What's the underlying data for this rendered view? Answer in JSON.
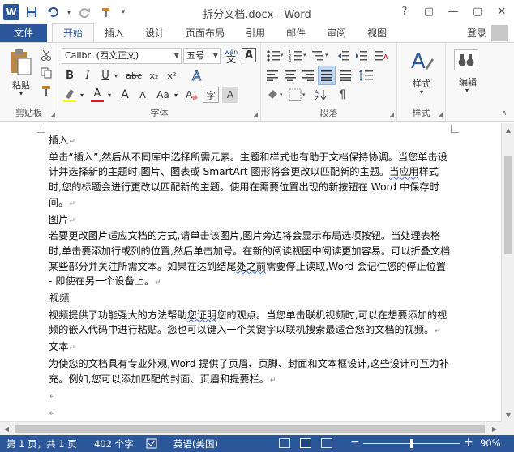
{
  "window": {
    "title": "拆分文档.docx - Word",
    "app_icon": "W",
    "help": "?",
    "restore": "▢",
    "minimize": "—",
    "close": "✕"
  },
  "qat": {
    "save_icon": "save-icon",
    "undo_icon": "undo-icon",
    "redo_icon": "redo-icon",
    "brush_icon": "format-painter-icon",
    "customize_icon": "chevron-down-icon"
  },
  "tabs": {
    "file": "文件",
    "items": [
      "开始",
      "插入",
      "设计",
      "页面布局",
      "引用",
      "邮件",
      "审阅",
      "视图"
    ],
    "active": "开始"
  },
  "account": {
    "login": "登录"
  },
  "ribbon": {
    "clipboard": {
      "label": "剪贴板",
      "paste": "粘贴"
    },
    "font": {
      "label": "字体",
      "font_name": "Calibri (西文正文)",
      "font_size": "五号",
      "pinyin": "wén",
      "bold": "B",
      "italic": "I",
      "underline": "U",
      "strike": "abc",
      "subscript": "x₂",
      "superscript": "x²",
      "grow": "A",
      "shrink": "A",
      "aa": "Aa",
      "font_color": "A",
      "highlight": "ab",
      "border_a": "A"
    },
    "paragraph": {
      "label": "段落"
    },
    "styles": {
      "label": "样式",
      "button": "样式"
    },
    "editing": {
      "button": "编辑"
    }
  },
  "document": {
    "paragraphs": [
      {
        "text": "插入",
        "mark": "↵"
      },
      {
        "text": "单击“插入”,然后从不同库中选择所需元素。主题和样式也有助于文档保持协调。当您单击设计并选择新的主题时,图片、图表或 SmartArt 图形将会更改以匹配新的主题。",
        "wavy": "当应用",
        "rest": "样式时,您的标题会进行更改以匹配新的主题。使用在需要位置出现的新按钮在 Word 中保存时间。",
        "mark": "↵"
      },
      {
        "text": "图片",
        "mark": "↵"
      },
      {
        "text": "若要更改图片适应文档的方式,请单击该图片,图片旁边将会显示布局选项按钮。当处理表格时,单击要添加行或列的位置,然后单击加号。在新的阅读视图中阅读更加容易。可以折叠文档某些部分并关注所需文本。如果在达到结尾",
        "wavy": "处之前",
        "rest": "需要停止读取,Word 会记住您的停止位置 - 即使在另一个设备上。",
        "mark": "↵"
      },
      {
        "text": "视频",
        "mark": ""
      },
      {
        "text": "视频提供了功能强大的方法帮助",
        "wavy": "您证明",
        "rest": "您的观点。当您单击联机视频时,可以在想要添加的视频的嵌入代码中进行粘贴。您也可以键入一个关键字以联机搜索最适合您的文档的视频。",
        "mark": "↵"
      },
      {
        "text": "文本",
        "mark": "↵"
      },
      {
        "text": "为使您的文档具有专业外观,Word 提供了页眉、页脚、封面和文本框设计,这些设计可互为补充。例如,您可以添加匹配的封面、页眉和提要栏。",
        "mark": "↵"
      },
      {
        "text": "",
        "mark": "↵"
      },
      {
        "text": "",
        "mark": "↵"
      }
    ]
  },
  "status": {
    "page": "第 1 页，共 1 页",
    "words": "402 个字",
    "lang": "英语(美国)",
    "zoom_minus": "−",
    "zoom_plus": "+",
    "zoom": "90%",
    "zoom_level": 0.9
  },
  "colors": {
    "accent": "#2b579a",
    "font_color_bar": "#e02020",
    "highlight_bar": "#ffff00"
  }
}
